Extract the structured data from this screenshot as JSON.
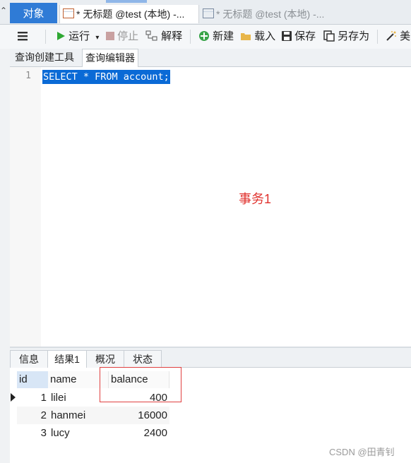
{
  "tabs": {
    "objects": "对象",
    "active_query": "* 无标题 @test (本地) -...",
    "inactive_query": "* 无标题 @test (本地) -..."
  },
  "toolbar": {
    "run": "运行",
    "stop": "停止",
    "explain": "解释",
    "new": "新建",
    "load": "载入",
    "save": "保存",
    "save_as": "另存为",
    "beautify": "美"
  },
  "editor_tabs": {
    "builder": "查询创建工具",
    "editor": "查询编辑器"
  },
  "editor": {
    "line_number": "1",
    "sql": "SELECT * FROM account;",
    "annotation": "事务1"
  },
  "result_tabs": {
    "info": "信息",
    "result1": "结果1",
    "profile": "概况",
    "status": "状态"
  },
  "table": {
    "columns": [
      "id",
      "name",
      "balance"
    ],
    "rows": [
      {
        "id": "1",
        "name": "lilei",
        "balance": "400"
      },
      {
        "id": "2",
        "name": "hanmei",
        "balance": "16000"
      },
      {
        "id": "3",
        "name": "lucy",
        "balance": "2400"
      }
    ]
  },
  "watermark": "CSDN @田青钊",
  "colors": {
    "accent": "#2f7bd6",
    "selection": "#0a6ad6",
    "annotation": "#e0322e",
    "highlight_box": "#e04040"
  }
}
